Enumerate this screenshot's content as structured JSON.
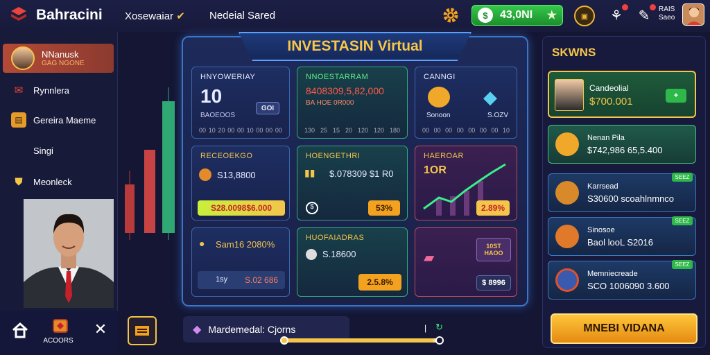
{
  "app": {
    "brand": "Bahracini"
  },
  "topnav": {
    "item1": "Xosewaiar",
    "item2": "Nedeial Sared"
  },
  "balance": {
    "value": "43,0NI"
  },
  "user": {
    "line1": "RAIS",
    "line2": "Saeo"
  },
  "sidebar": {
    "profile": {
      "name": "NNanusk",
      "sub": "GAG NGONE"
    },
    "items": [
      {
        "label": "Rynnlera"
      },
      {
        "label": "Gereira Maeme"
      },
      {
        "label": "Singi"
      },
      {
        "label": "Meonleck"
      }
    ],
    "bottom_label": "ACOORS"
  },
  "main": {
    "title": "INVESTASIN Virtual",
    "cards": {
      "c1": {
        "title": "HNYOWERIAY",
        "value": "10",
        "sub": "BAOEOOS",
        "button": "GOI",
        "ticks": [
          "00",
          "10",
          "20",
          "00",
          "00",
          "10",
          "00",
          "00",
          "00"
        ]
      },
      "c2": {
        "title": "NNOESTARRAM",
        "line1": "8408309,5,82,000",
        "line2": "BA  HOE  0R000",
        "ticks": [
          "130",
          "25",
          "15",
          "20",
          "120",
          "120",
          "180"
        ]
      },
      "c3": {
        "title": "CANNGI",
        "lbl1": "Sonoon",
        "lbl2": "S.OZV",
        "ticks": [
          "00",
          "00",
          "00",
          "00",
          "00",
          "00",
          "00",
          "10"
        ]
      },
      "c4": {
        "title": "RECEOEKGO",
        "value": "S13,8800",
        "pill": "S28.0098$6.000"
      },
      "c5": {
        "title": "HOENGETHRI",
        "value": "$.078309 $1 R0",
        "pill": "53%"
      },
      "c6": {
        "title": "HAEROAR",
        "big": "1OR",
        "pill": "2.89%"
      },
      "c7": {
        "line": "Sam16  2080%",
        "foot1": "1sy",
        "foot2": "S.02 686"
      },
      "c8": {
        "title": "HUOFAIADRAS",
        "value": "S.18600",
        "pill": "2.5.8%"
      },
      "c9": {
        "btn1a": "10ST",
        "btn1b": "HAOO",
        "btn2": "$ 8996"
      }
    }
  },
  "right": {
    "title": "SKWNS",
    "items": [
      {
        "t1": "Candeolial",
        "t2": "$700.001",
        "tag": ""
      },
      {
        "t1": "Nenan Pila",
        "t2": "$742,986 65,5.400",
        "tag": ""
      },
      {
        "t1": "Karrsead",
        "t2": "S30600 scoahlnmnco",
        "tag": "SEEZ"
      },
      {
        "t1": "Sinosoe",
        "t2": "Baol looL S2016",
        "tag": "SEEZ"
      },
      {
        "t1": "Memniecreade",
        "t2": "SCO 1006090 3.600",
        "tag": "SEEZ"
      }
    ],
    "cta": "MNEBI VIDANA"
  },
  "bottom": {
    "search": "Mardemedal: Cjorns"
  },
  "colors": {
    "accent": "#f3c54a",
    "green": "#2fb84a",
    "panel": "#1b2048"
  }
}
